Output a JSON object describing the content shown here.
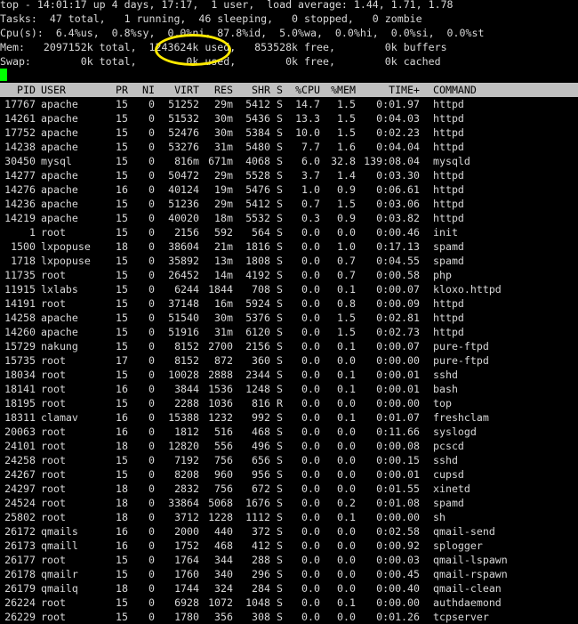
{
  "summary": {
    "line1": "top - 14:01:17 up 4 days, 17:17,  1 user,  load average: 1.44, 1.71, 1.78",
    "line2": "Tasks:  47 total,   1 running,  46 sleeping,   0 stopped,   0 zombie",
    "line3": "Cpu(s):  6.4%us,  0.8%sy,  0.0%ni, 87.8%id,  5.0%wa,  0.0%hi,  0.0%si,  0.0%st",
    "line4": "Mem:   2097152k total,  1243624k used,   853528k free,        0k buffers",
    "line5": "Swap:        0k total,        0k used,        0k free,        0k cached"
  },
  "header": {
    "pid": "PID",
    "user": "USER",
    "pr": "PR",
    "ni": "NI",
    "virt": "VIRT",
    "res": "RES",
    "shr": "SHR",
    "s": "S",
    "cpu": "%CPU",
    "mem": "%MEM",
    "time": "TIME+",
    "command": "COMMAND"
  },
  "processes": [
    [
      "17767",
      "apache",
      "15",
      "0",
      "51252",
      "29m",
      "5412",
      "S",
      "14.7",
      "1.5",
      "0:01.97",
      "httpd"
    ],
    [
      "14261",
      "apache",
      "15",
      "0",
      "51532",
      "30m",
      "5436",
      "S",
      "13.3",
      "1.5",
      "0:04.03",
      "httpd"
    ],
    [
      "17752",
      "apache",
      "15",
      "0",
      "52476",
      "30m",
      "5384",
      "S",
      "10.0",
      "1.5",
      "0:02.23",
      "httpd"
    ],
    [
      "14238",
      "apache",
      "15",
      "0",
      "53276",
      "31m",
      "5480",
      "S",
      "7.7",
      "1.6",
      "0:04.04",
      "httpd"
    ],
    [
      "30450",
      "mysql",
      "15",
      "0",
      "816m",
      "671m",
      "4068",
      "S",
      "6.0",
      "32.8",
      "139:08.04",
      "mysqld"
    ],
    [
      "14277",
      "apache",
      "15",
      "0",
      "50472",
      "29m",
      "5528",
      "S",
      "3.7",
      "1.4",
      "0:03.30",
      "httpd"
    ],
    [
      "14276",
      "apache",
      "16",
      "0",
      "40124",
      "19m",
      "5476",
      "S",
      "1.0",
      "0.9",
      "0:06.61",
      "httpd"
    ],
    [
      "14236",
      "apache",
      "15",
      "0",
      "51236",
      "29m",
      "5412",
      "S",
      "0.7",
      "1.5",
      "0:03.06",
      "httpd"
    ],
    [
      "14219",
      "apache",
      "15",
      "0",
      "40020",
      "18m",
      "5532",
      "S",
      "0.3",
      "0.9",
      "0:03.82",
      "httpd"
    ],
    [
      "1",
      "root",
      "15",
      "0",
      "2156",
      "592",
      "564",
      "S",
      "0.0",
      "0.0",
      "0:00.46",
      "init"
    ],
    [
      "1500",
      "lxpopuse",
      "18",
      "0",
      "38604",
      "21m",
      "1816",
      "S",
      "0.0",
      "1.0",
      "0:17.13",
      "spamd"
    ],
    [
      "1718",
      "lxpopuse",
      "15",
      "0",
      "35892",
      "13m",
      "1808",
      "S",
      "0.0",
      "0.7",
      "0:04.55",
      "spamd"
    ],
    [
      "11735",
      "root",
      "15",
      "0",
      "26452",
      "14m",
      "4192",
      "S",
      "0.0",
      "0.7",
      "0:00.58",
      "php"
    ],
    [
      "11915",
      "lxlabs",
      "15",
      "0",
      "6244",
      "1844",
      "708",
      "S",
      "0.0",
      "0.1",
      "0:00.07",
      "kloxo.httpd"
    ],
    [
      "14191",
      "root",
      "15",
      "0",
      "37148",
      "16m",
      "5924",
      "S",
      "0.0",
      "0.8",
      "0:00.09",
      "httpd"
    ],
    [
      "14258",
      "apache",
      "15",
      "0",
      "51540",
      "30m",
      "5376",
      "S",
      "0.0",
      "1.5",
      "0:02.81",
      "httpd"
    ],
    [
      "14260",
      "apache",
      "15",
      "0",
      "51916",
      "31m",
      "6120",
      "S",
      "0.0",
      "1.5",
      "0:02.73",
      "httpd"
    ],
    [
      "15729",
      "nakung",
      "15",
      "0",
      "8152",
      "2700",
      "2156",
      "S",
      "0.0",
      "0.1",
      "0:00.07",
      "pure-ftpd"
    ],
    [
      "15735",
      "root",
      "17",
      "0",
      "8152",
      "872",
      "360",
      "S",
      "0.0",
      "0.0",
      "0:00.00",
      "pure-ftpd"
    ],
    [
      "18034",
      "root",
      "15",
      "0",
      "10028",
      "2888",
      "2344",
      "S",
      "0.0",
      "0.1",
      "0:00.01",
      "sshd"
    ],
    [
      "18141",
      "root",
      "16",
      "0",
      "3844",
      "1536",
      "1248",
      "S",
      "0.0",
      "0.1",
      "0:00.01",
      "bash"
    ],
    [
      "18195",
      "root",
      "15",
      "0",
      "2288",
      "1036",
      "816",
      "R",
      "0.0",
      "0.0",
      "0:00.00",
      "top"
    ],
    [
      "18311",
      "clamav",
      "16",
      "0",
      "15388",
      "1232",
      "992",
      "S",
      "0.0",
      "0.1",
      "0:01.07",
      "freshclam"
    ],
    [
      "20063",
      "root",
      "16",
      "0",
      "1812",
      "516",
      "468",
      "S",
      "0.0",
      "0.0",
      "0:11.66",
      "syslogd"
    ],
    [
      "24101",
      "root",
      "18",
      "0",
      "12820",
      "556",
      "496",
      "S",
      "0.0",
      "0.0",
      "0:00.08",
      "pcscd"
    ],
    [
      "24258",
      "root",
      "15",
      "0",
      "7192",
      "756",
      "656",
      "S",
      "0.0",
      "0.0",
      "0:00.15",
      "sshd"
    ],
    [
      "24267",
      "root",
      "15",
      "0",
      "8208",
      "960",
      "956",
      "S",
      "0.0",
      "0.0",
      "0:00.01",
      "cupsd"
    ],
    [
      "24297",
      "root",
      "18",
      "0",
      "2832",
      "756",
      "672",
      "S",
      "0.0",
      "0.0",
      "0:01.55",
      "xinetd"
    ],
    [
      "24524",
      "root",
      "18",
      "0",
      "33864",
      "5068",
      "1676",
      "S",
      "0.0",
      "0.2",
      "0:01.08",
      "spamd"
    ],
    [
      "25802",
      "root",
      "18",
      "0",
      "3712",
      "1228",
      "1112",
      "S",
      "0.0",
      "0.1",
      "0:00.00",
      "sh"
    ],
    [
      "26172",
      "qmails",
      "16",
      "0",
      "2000",
      "440",
      "372",
      "S",
      "0.0",
      "0.0",
      "0:02.58",
      "qmail-send"
    ],
    [
      "26173",
      "qmaill",
      "16",
      "0",
      "1752",
      "468",
      "412",
      "S",
      "0.0",
      "0.0",
      "0:00.92",
      "splogger"
    ],
    [
      "26177",
      "root",
      "15",
      "0",
      "1764",
      "344",
      "288",
      "S",
      "0.0",
      "0.0",
      "0:00.03",
      "qmail-lspawn"
    ],
    [
      "26178",
      "qmailr",
      "15",
      "0",
      "1760",
      "340",
      "296",
      "S",
      "0.0",
      "0.0",
      "0:00.45",
      "qmail-rspawn"
    ],
    [
      "26179",
      "qmailq",
      "18",
      "0",
      "1744",
      "324",
      "284",
      "S",
      "0.0",
      "0.0",
      "0:00.40",
      "qmail-clean"
    ],
    [
      "26224",
      "root",
      "15",
      "0",
      "6928",
      "1072",
      "1048",
      "S",
      "0.0",
      "0.1",
      "0:00.00",
      "authdaemond"
    ],
    [
      "26229",
      "root",
      "15",
      "0",
      "1780",
      "356",
      "308",
      "S",
      "0.0",
      "0.0",
      "0:01.26",
      "tcpserver"
    ]
  ],
  "colors": {
    "background": "#000000",
    "text": "#d8d8d8",
    "header_bar": "#c0c0c0",
    "cursor": "#00ff00",
    "annotation": "#ffea00"
  }
}
